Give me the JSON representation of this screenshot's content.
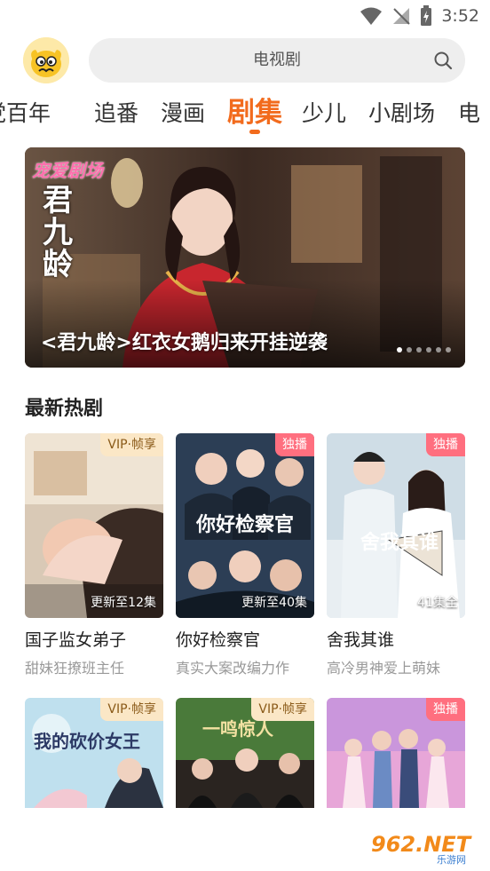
{
  "status": {
    "time": "3:52"
  },
  "search": {
    "text": "电视剧"
  },
  "tabs": [
    "党百年",
    "追番",
    "漫画",
    "剧集",
    "少儿",
    "小剧场",
    "电"
  ],
  "active_tab": "剧集",
  "banner": {
    "caption": "<君九龄>红衣女鹅归来开挂逆袭",
    "logo_text": "宠爱剧场",
    "title_art": "君九龄",
    "dots": 6
  },
  "section": {
    "title": "最新热剧"
  },
  "cards": [
    {
      "title": "国子监女弟子",
      "subtitle": "甜妹狂撩班主任",
      "badge": "VIP·帧享",
      "badge_type": "vip",
      "update": "更新至12集"
    },
    {
      "title": "你好检察官",
      "subtitle": "真实大案改编力作",
      "badge": "独播",
      "badge_type": "exclusive",
      "update": "更新至40集",
      "art": "你好检察官"
    },
    {
      "title": "舍我其谁",
      "subtitle": "高冷男神爱上萌妹",
      "badge": "独播",
      "badge_type": "exclusive",
      "update": "41集全",
      "art": "舍我其谁"
    }
  ],
  "cards_row2": [
    {
      "badge": "VIP·帧享",
      "badge_type": "vip",
      "art": "我的砍价女王"
    },
    {
      "badge": "VIP·帧享",
      "badge_type": "vip",
      "art": "一鸣惊人"
    },
    {
      "badge": "独播",
      "badge_type": "exclusive"
    }
  ],
  "watermark": {
    "text": "962.NET",
    "sub": "乐游网"
  },
  "colors": {
    "accent": "#f26b1d",
    "exclusive": "#ff6f7f",
    "vip_bg": "#fbe7c6"
  }
}
